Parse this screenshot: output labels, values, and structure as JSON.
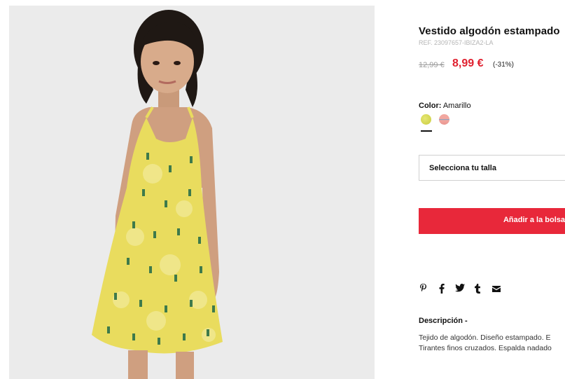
{
  "product": {
    "title": "Vestido algodón estampado",
    "ref": "REF. 23097657-IBIZA2-LA",
    "old_price": "12,99 €",
    "new_price": "8,99 €",
    "discount": "(-31%)"
  },
  "color": {
    "label": "Color:",
    "value": "Amarillo",
    "swatches": [
      {
        "name": "Amarillo",
        "hex": "#d6d851"
      },
      {
        "name": "Rosa",
        "hex": "#f2a7a0"
      }
    ]
  },
  "size": {
    "placeholder": "Selecciona tu talla"
  },
  "cart": {
    "add_label": "Añadir a la bolsa"
  },
  "share": {
    "icons": [
      "pinterest-icon",
      "facebook-icon",
      "twitter-icon",
      "tumblr-icon",
      "mail-icon"
    ]
  },
  "description": {
    "heading": "Descripción -",
    "line1": "Tejido de algodón. Diseño estampado. E",
    "line2": "Tirantes finos cruzados. Espalda nadado"
  },
  "colors": {
    "accent": "#e8283a",
    "price": "#e0202f",
    "photo_bg": "#ebebeb",
    "dress": "#e9dc5e"
  }
}
